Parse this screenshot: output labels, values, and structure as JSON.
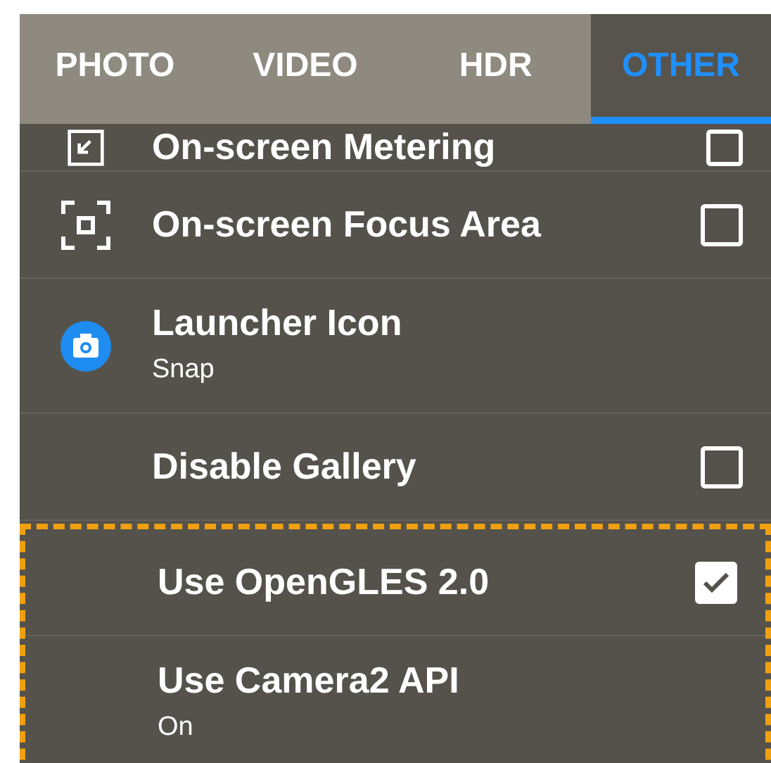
{
  "tabs": [
    {
      "label": "PHOTO",
      "selected": false
    },
    {
      "label": "VIDEO",
      "selected": false
    },
    {
      "label": "HDR",
      "selected": false
    },
    {
      "label": "OTHER",
      "selected": true
    }
  ],
  "settings": [
    {
      "title": "On-screen Metering",
      "kind": "checkbox",
      "checked": false
    },
    {
      "title": "On-screen Focus Area",
      "kind": "checkbox",
      "checked": false
    },
    {
      "title": "Launcher Icon",
      "subtitle": "Snap",
      "kind": "value"
    },
    {
      "title": "Disable Gallery",
      "kind": "checkbox",
      "checked": false
    }
  ],
  "highlighted_settings": [
    {
      "title": "Use OpenGLES 2.0",
      "kind": "checkbox",
      "checked": true
    },
    {
      "title": "Use Camera2 API",
      "subtitle": "On",
      "kind": "value"
    }
  ]
}
